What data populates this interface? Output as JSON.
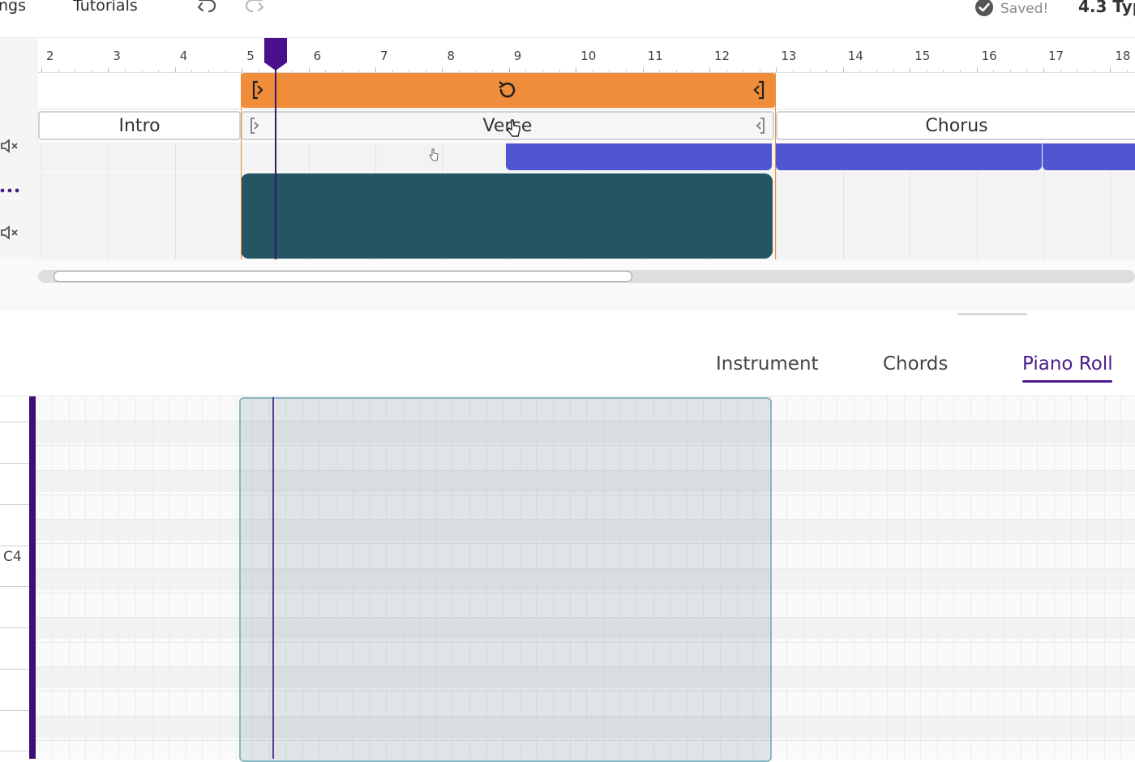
{
  "topbar": {
    "settings_label": "ngs",
    "tutorials_label": "Tutorials",
    "saved_label": "Saved!",
    "version_label": "4.3 Typ"
  },
  "ruler": {
    "numbers": [
      "2",
      "3",
      "4",
      "5",
      "6",
      "7",
      "8",
      "9",
      "10",
      "11",
      "12",
      "13",
      "14",
      "15",
      "16",
      "17",
      "18"
    ]
  },
  "sections": {
    "intro": "Intro",
    "verse": "Verse",
    "chorus": "Chorus"
  },
  "tabs": {
    "instrument": "Instrument",
    "chords": "Chords",
    "piano_roll": "Piano Roll"
  },
  "piano_roll": {
    "c4_label": "C4"
  },
  "colors": {
    "loop": "#ef8d3b",
    "blue_clip": "#4f56cf",
    "teal_clip": "#245562",
    "accent": "#4a1d8a"
  }
}
